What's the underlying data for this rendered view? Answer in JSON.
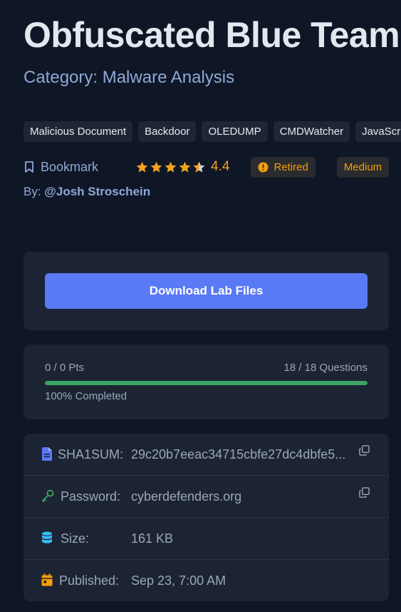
{
  "lab": {
    "title": "Obfuscated Blue Team",
    "category": "Category: Malware Analysis",
    "tags": [
      "Malicious Document",
      "Backdoor",
      "OLEDUMP",
      "CMDWatcher",
      "JavaScript"
    ],
    "bookmark_label": "Bookmark",
    "rating": "4.4",
    "rating_stars": 4.4,
    "status_badge": "Retired",
    "difficulty_badge": "Medium",
    "author_prefix": "By: ",
    "author": "@Josh Stroschein"
  },
  "download": {
    "button_label": "Download Lab Files"
  },
  "progress": {
    "points": "0 / 0 Pts",
    "questions": "18 / 18 Questions",
    "completed_label": "100% Completed",
    "fraction": 1.0
  },
  "info": {
    "sha1_label": "SHA1SUM:",
    "sha1_value": "29c20b7eeac34715cbfe27dc4dbfe5...",
    "password_label": "Password:",
    "password_value": "cyberdefenders.org",
    "size_label": "Size:",
    "size_value": "161 KB",
    "published_label": "Published:",
    "published_value": "Sep 23, 7:00 AM"
  },
  "colors": {
    "background": "#0f1626",
    "card": "#1c2433",
    "accent_button": "#5a79f4",
    "progress_fill": "#3ca564",
    "star": "#f0a21f",
    "badge_text": "#f59e0b",
    "link_text": "#8fa8d6"
  },
  "icons": {
    "bookmark": "bookmark-icon",
    "star": "star-icon",
    "retired": "alert-circle-icon",
    "sha1": "file-icon",
    "password": "key-icon",
    "size": "database-icon",
    "published": "calendar-icon",
    "copy": "copy-icon"
  }
}
